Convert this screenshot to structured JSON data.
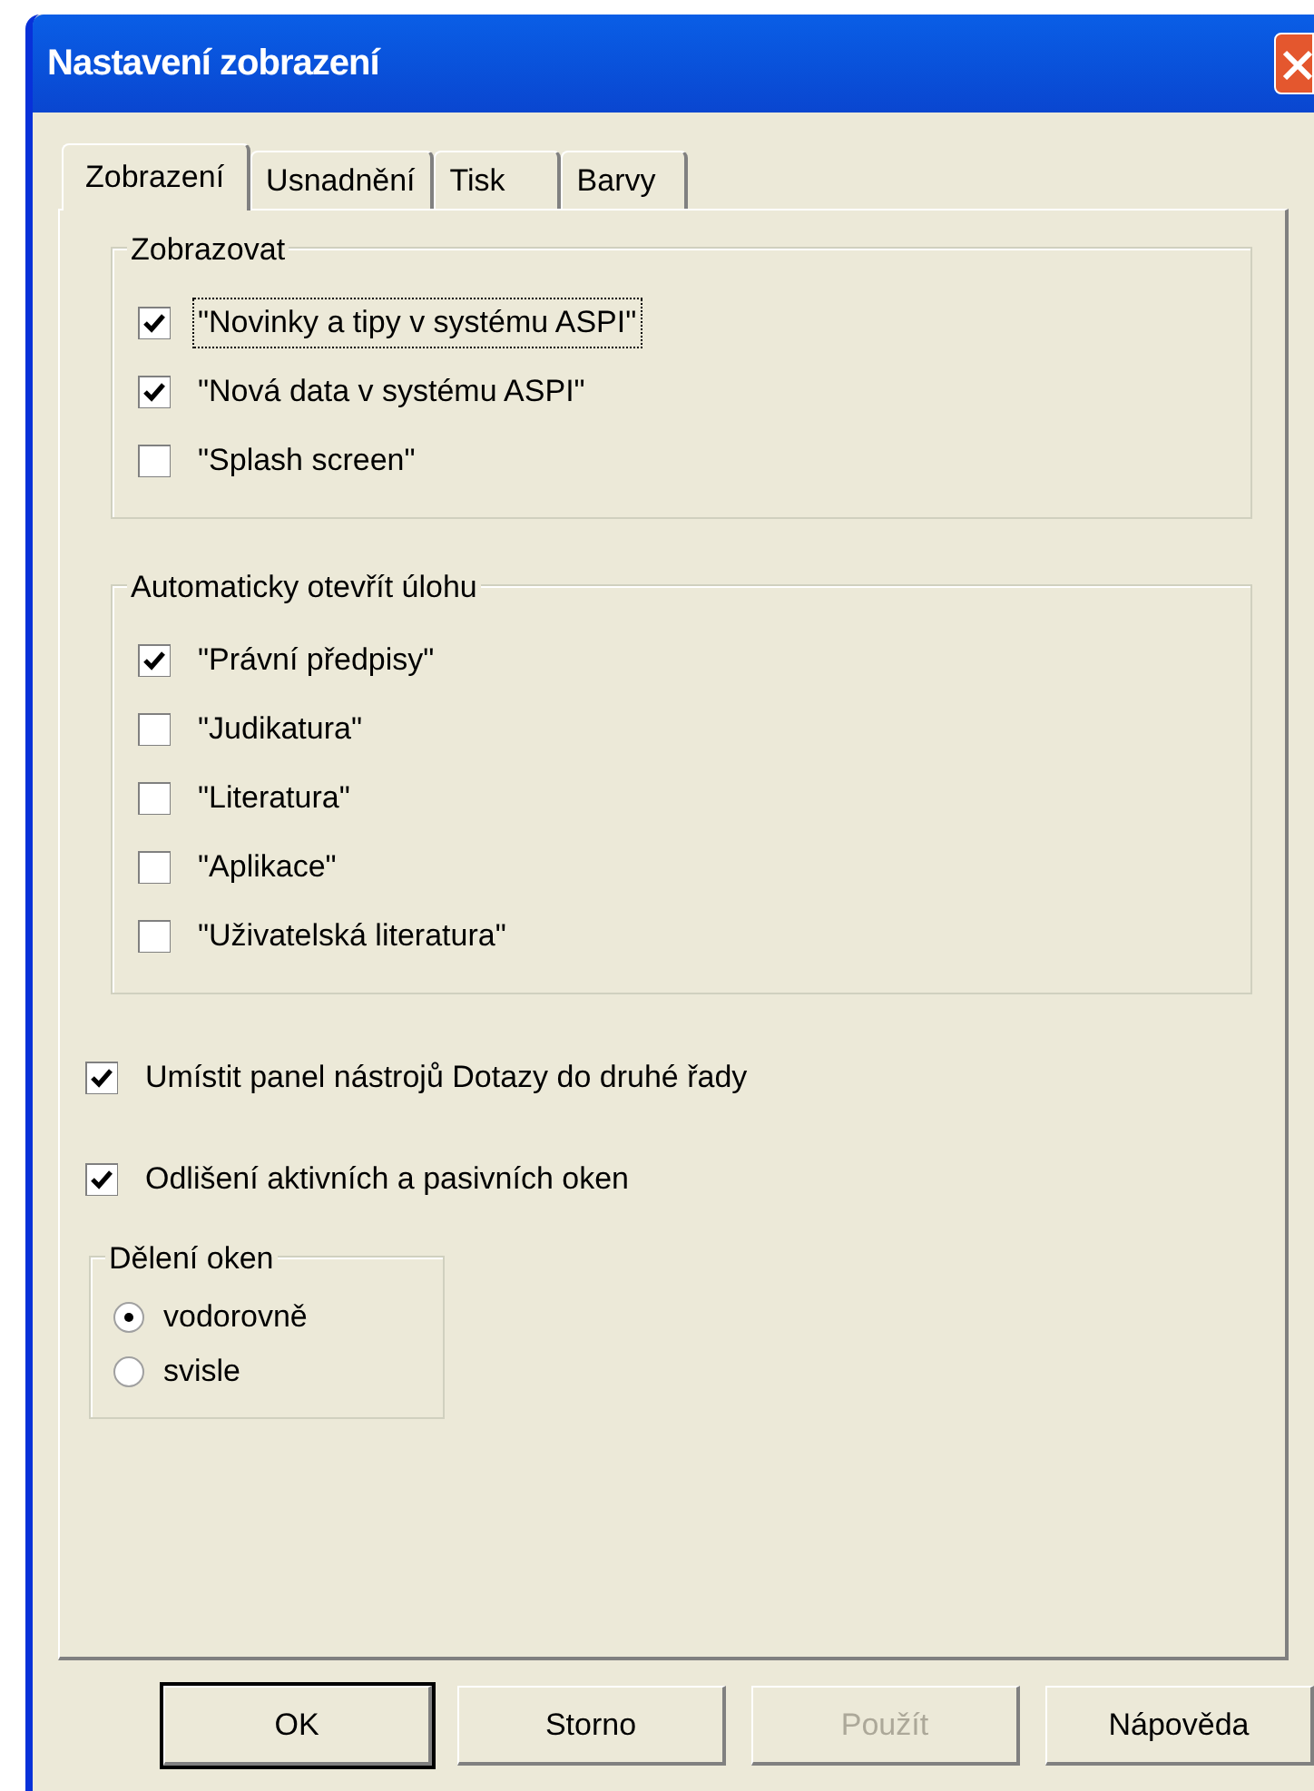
{
  "window": {
    "title": "Nastavení zobrazení"
  },
  "tabs": [
    {
      "label": "Zobrazení",
      "selected": true
    },
    {
      "label": "Usnadnění",
      "selected": false
    },
    {
      "label": "Tisk",
      "selected": false
    },
    {
      "label": "Barvy",
      "selected": false
    }
  ],
  "groups": [
    {
      "title": "Zobrazovat",
      "items": [
        {
          "label": "\"Novinky a tipy v systému ASPI\"",
          "checked": true,
          "focused": true
        },
        {
          "label": "\"Nová data v systému ASPI\"",
          "checked": true,
          "focused": false
        },
        {
          "label": "\"Splash screen\"",
          "checked": false,
          "focused": false
        }
      ]
    },
    {
      "title": "Automaticky otevřít úlohu",
      "items": [
        {
          "label": "\"Právní předpisy\"",
          "checked": true,
          "focused": false
        },
        {
          "label": "\"Judikatura\"",
          "checked": false,
          "focused": false
        },
        {
          "label": "\"Literatura\"",
          "checked": false,
          "focused": false
        },
        {
          "label": "\"Aplikace\"",
          "checked": false,
          "focused": false
        },
        {
          "label": "\"Uživatelská literatura\"",
          "checked": false,
          "focused": false
        }
      ]
    }
  ],
  "options": [
    {
      "label": "Umístit panel nástrojů Dotazy do druhé řady",
      "checked": true
    },
    {
      "label": "Odlišení aktivních a pasivních oken",
      "checked": true
    }
  ],
  "split": {
    "title": "Dělení oken",
    "options": [
      {
        "label": "vodorovně",
        "selected": true
      },
      {
        "label": "svisle",
        "selected": false
      }
    ]
  },
  "buttons": [
    {
      "label": "OK",
      "disabled": false,
      "default": true
    },
    {
      "label": "Storno",
      "disabled": false,
      "default": false
    },
    {
      "label": "Použít",
      "disabled": true,
      "default": false
    },
    {
      "label": "Nápověda",
      "disabled": false,
      "default": false
    }
  ]
}
